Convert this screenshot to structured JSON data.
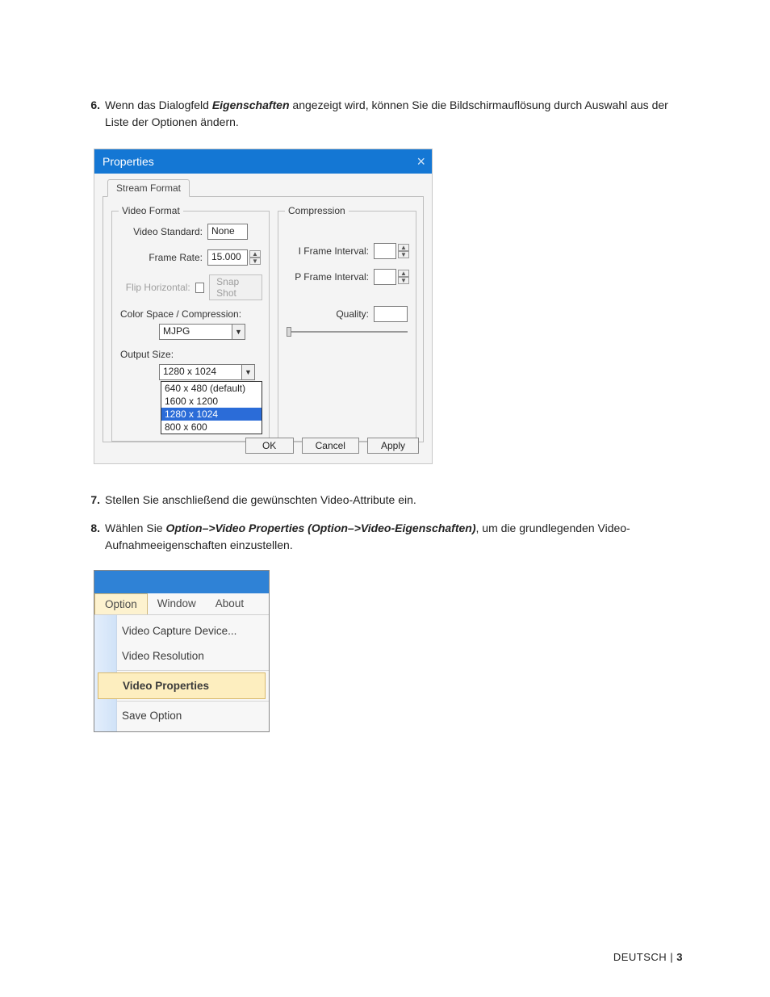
{
  "steps": {
    "s6": {
      "num": "6.",
      "pre": "Wenn das Dialogfeld ",
      "bold": "Eigenschaften",
      "post": " angezeigt wird, können Sie die Bildschirmauflösung durch Auswahl aus der Liste der Optionen ändern."
    },
    "s7": {
      "num": "7.",
      "text": "Stellen Sie anschließend die gewünschten Video-Attribute ein."
    },
    "s8": {
      "num": "8.",
      "pre": "Wählen Sie ",
      "bold": "Option–>Video Properties (Option–>Video-Eigenschaften)",
      "post": ", um die grundlegenden Video-Aufnahmeeigenschaften einzustellen."
    }
  },
  "dlg": {
    "title": "Properties",
    "tab": "Stream Format",
    "group_video": "Video Format",
    "group_comp": "Compression",
    "lbl_std": "Video Standard:",
    "val_std": "None",
    "lbl_fps": "Frame Rate:",
    "val_fps": "15.000",
    "lbl_flip": "Flip Horizontal:",
    "btn_snap": "Snap Shot",
    "lbl_csc": "Color Space / Compression:",
    "val_csc": "MJPG",
    "lbl_out": "Output Size:",
    "val_out": "1280 x 1024",
    "lbl_ifi": "I Frame Interval:",
    "lbl_pfi": "P Frame Interval:",
    "lbl_quality": "Quality:",
    "btn_ok": "OK",
    "btn_cancel": "Cancel",
    "btn_apply": "Apply",
    "sizes": [
      "640 x 480  (default)",
      "1600 x 1200",
      "1280 x 1024",
      "800 x 600"
    ]
  },
  "menu": {
    "bar": {
      "option": "Option",
      "window": "Window",
      "about": "About"
    },
    "items": {
      "capture": "Video Capture Device...",
      "resolution": "Video Resolution",
      "properties": "Video Properties",
      "save": "Save Option"
    }
  },
  "footer": {
    "lang": "DEUTSCH",
    "sep": " | ",
    "page": "3"
  }
}
